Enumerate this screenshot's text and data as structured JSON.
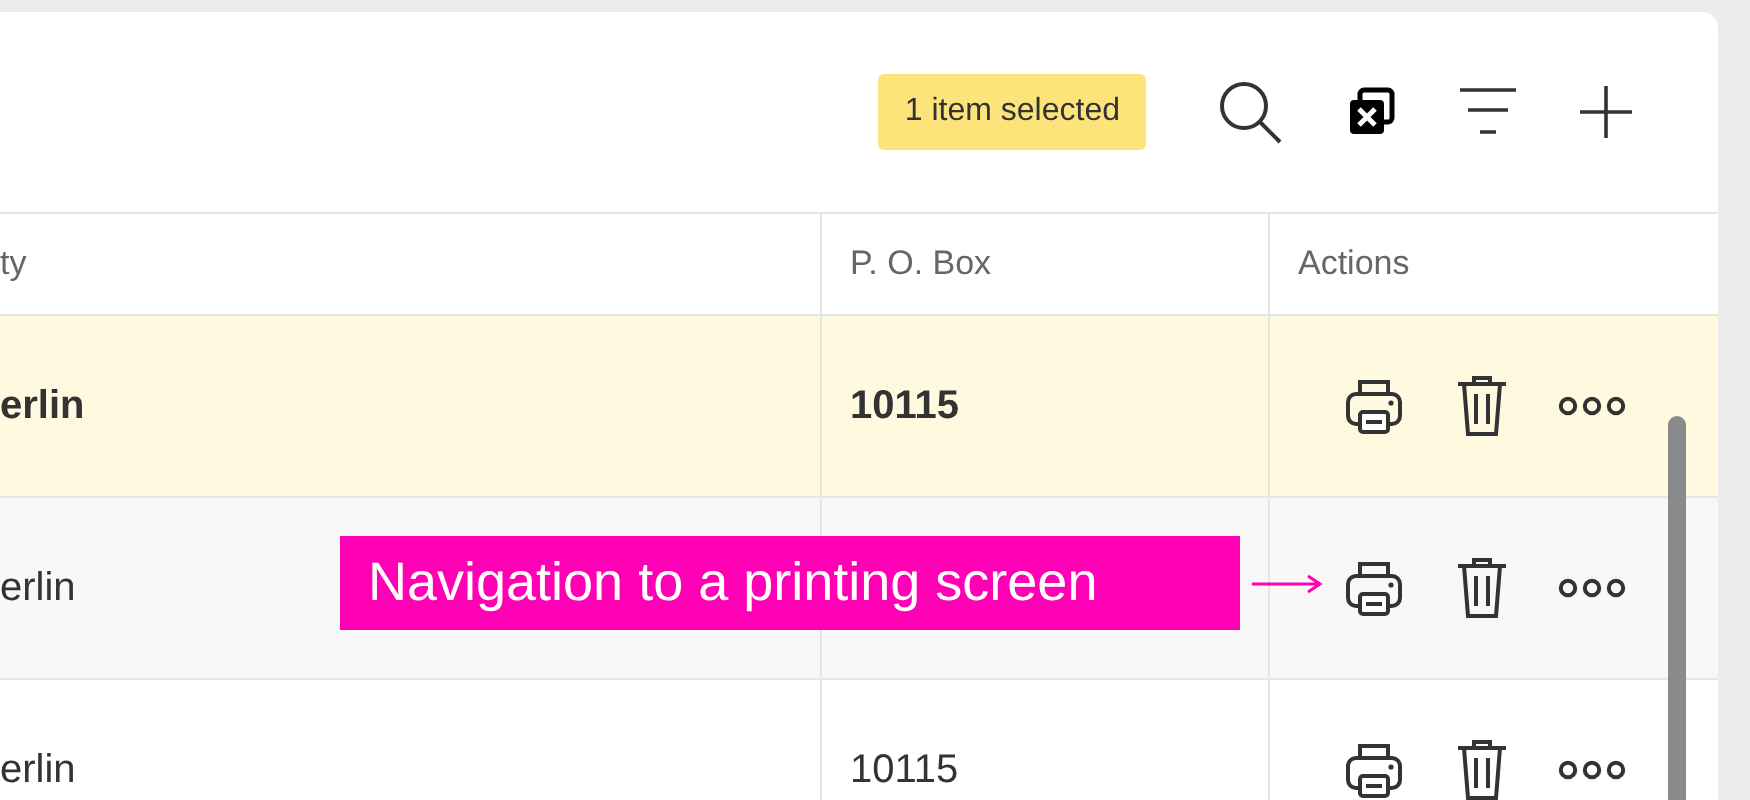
{
  "toolbar": {
    "selection_badge": "1 item selected"
  },
  "table": {
    "columns": [
      "ty",
      "P. O. Box",
      "Actions"
    ],
    "rows": [
      {
        "city": "erlin",
        "p_o_box": "10115",
        "selected": true
      },
      {
        "city": "erlin",
        "selected": false
      },
      {
        "city": "erlin",
        "p_o_box": "10115",
        "selected": false
      }
    ]
  },
  "annotation": {
    "text": "Navigation to a printing screen"
  }
}
